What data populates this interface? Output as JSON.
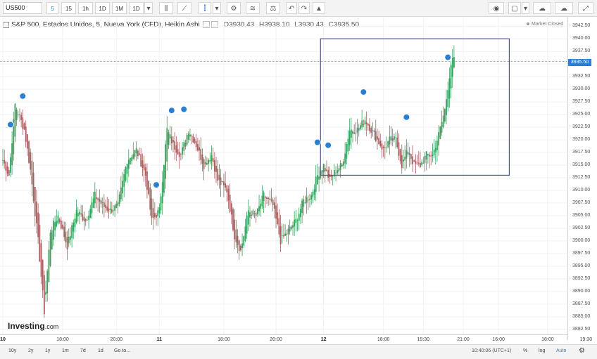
{
  "toolbar": {
    "symbol": "US500",
    "timeframes": [
      "5",
      "15",
      "1h",
      "1D",
      "1M",
      "1D"
    ],
    "active_timeframe": "5"
  },
  "legend": {
    "title": "S&P 500, Estados Unidos, 5, Nueva York (CFD), Heikin Ashi",
    "open": "O3930.43",
    "high": "H3938.10",
    "low": "L3930.43",
    "close": "C3935.50",
    "market_status": "Market Closed"
  },
  "current_price_label": "3935.50",
  "logo": {
    "text": "Investing",
    "suffix": ".com"
  },
  "bottom": {
    "ranges": [
      "10y",
      "2y",
      "1y",
      "1m",
      "7d",
      "1d",
      "Go to..."
    ],
    "clock": "10:40:06 (UTC+1)",
    "buttons": [
      "%",
      "log",
      "Auto"
    ]
  },
  "colors": {
    "up": "#38a15e",
    "down": "#a5605f",
    "highlight_box": "#4a4fa6",
    "accent": "#2a7fd4"
  },
  "chart_data": {
    "type": "candlestick",
    "style": "Heikin Ashi",
    "ylim": [
      3881.5,
      3944.2
    ],
    "y_ticks": [
      "3942.50",
      "3940.00",
      "3937.50",
      "3935.00",
      "3932.50",
      "3930.00",
      "3927.50",
      "3925.00",
      "3922.50",
      "3920.00",
      "3917.50",
      "3915.00",
      "3912.50",
      "3910.00",
      "3907.50",
      "3905.00",
      "3902.50",
      "3900.00",
      "3897.50",
      "3895.00",
      "3892.50",
      "3890.00",
      "3887.50",
      "3885.00",
      "3882.50"
    ],
    "x_ticks": [
      {
        "label": "10",
        "bold": true,
        "index": 0
      },
      {
        "label": "18:00",
        "bold": false,
        "index": 39
      },
      {
        "label": "20:00",
        "bold": false,
        "index": 74
      },
      {
        "label": "11",
        "bold": true,
        "index": 102
      },
      {
        "label": "18:00",
        "bold": false,
        "index": 144
      },
      {
        "label": "20:00",
        "bold": false,
        "index": 178
      },
      {
        "label": "12",
        "bold": true,
        "index": 209
      },
      {
        "label": "18:00",
        "bold": false,
        "index": 248
      },
      {
        "label": "19:30",
        "bold": false,
        "index": 274
      },
      {
        "label": "21:00",
        "bold": false,
        "index": 300
      },
      {
        "label": "16:00",
        "bold": false,
        "index": 323
      },
      {
        "label": "18:00",
        "bold": false,
        "index": 355
      },
      {
        "label": "19:30",
        "bold": false,
        "index": 380
      }
    ],
    "waypoints": [
      [
        0,
        3916
      ],
      [
        4,
        3913
      ],
      [
        8,
        3927
      ],
      [
        14,
        3922
      ],
      [
        18,
        3914
      ],
      [
        23,
        3900
      ],
      [
        27,
        3886
      ],
      [
        31,
        3902
      ],
      [
        36,
        3905
      ],
      [
        42,
        3899
      ],
      [
        48,
        3906
      ],
      [
        54,
        3904
      ],
      [
        60,
        3909
      ],
      [
        65,
        3907
      ],
      [
        70,
        3906
      ],
      [
        75,
        3907
      ],
      [
        81,
        3916
      ],
      [
        87,
        3918
      ],
      [
        93,
        3913
      ],
      [
        97,
        3904
      ],
      [
        102,
        3906
      ],
      [
        107,
        3922
      ],
      [
        111,
        3919
      ],
      [
        116,
        3917
      ],
      [
        121,
        3922
      ],
      [
        126,
        3919
      ],
      [
        131,
        3915
      ],
      [
        136,
        3917
      ],
      [
        140,
        3912
      ],
      [
        146,
        3910
      ],
      [
        151,
        3901
      ],
      [
        155,
        3898
      ],
      [
        160,
        3906
      ],
      [
        165,
        3905
      ],
      [
        170,
        3909
      ],
      [
        176,
        3907
      ],
      [
        181,
        3900
      ],
      [
        186,
        3902
      ],
      [
        191,
        3904
      ],
      [
        196,
        3908
      ],
      [
        201,
        3909
      ],
      [
        205,
        3913
      ],
      [
        209,
        3915
      ],
      [
        213,
        3912
      ],
      [
        217,
        3914
      ],
      [
        221,
        3915
      ],
      [
        226,
        3922
      ],
      [
        231,
        3922
      ],
      [
        236,
        3924
      ],
      [
        242,
        3921
      ],
      [
        248,
        3918
      ],
      [
        252,
        3920
      ],
      [
        256,
        3920
      ],
      [
        260,
        3915
      ],
      [
        264,
        3918
      ],
      [
        268,
        3915
      ],
      [
        272,
        3915
      ],
      [
        276,
        3917
      ],
      [
        280,
        3917
      ],
      [
        284,
        3921
      ],
      [
        288,
        3926
      ],
      [
        292,
        3935
      ],
      [
        294,
        3936
      ]
    ],
    "events_at": [
      5,
      13,
      110,
      118,
      100,
      205,
      212,
      235,
      263,
      290
    ],
    "highlight_box": {
      "x_start": 207,
      "x_end": 330,
      "y_high": 3940.0,
      "y_low": 3913.0
    },
    "current_price": 3935.5
  }
}
